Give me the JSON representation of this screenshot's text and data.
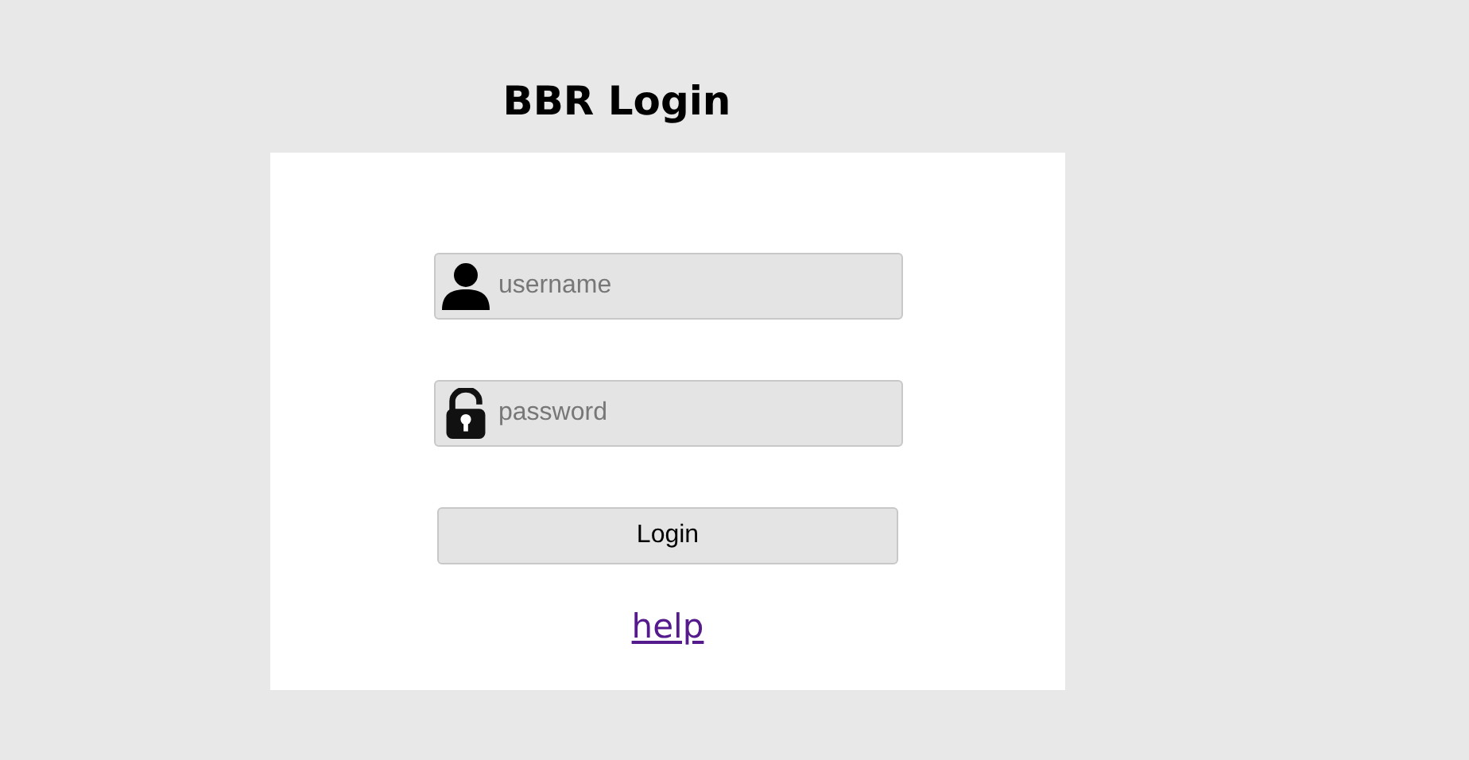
{
  "title": "BBR Login",
  "fields": [
    {
      "kind": "user",
      "placeholder": "username"
    },
    {
      "kind": "lock",
      "placeholder": "password"
    }
  ],
  "button": "Login",
  "link": "help"
}
